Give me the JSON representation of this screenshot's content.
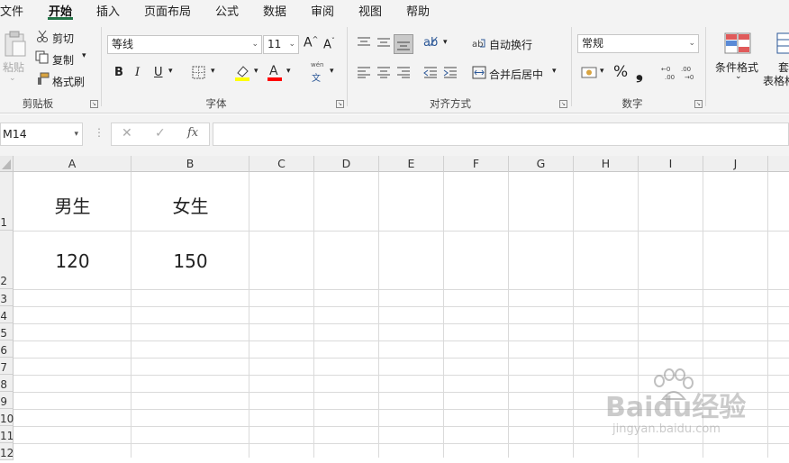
{
  "menu": {
    "items": [
      "文件",
      "开始",
      "插入",
      "页面布局",
      "公式",
      "数据",
      "审阅",
      "视图",
      "帮助"
    ]
  },
  "clipboard": {
    "paste": "粘贴",
    "cut": "剪切",
    "copy": "复制",
    "format_painter": "格式刷",
    "label": "剪贴板"
  },
  "font": {
    "family": "等线",
    "size": "11",
    "label": "字体",
    "bold": "B",
    "italic": "I",
    "underline": "U",
    "phonetic": "wén",
    "phonetic_char": "文"
  },
  "alignment": {
    "wrap_text": "自动换行",
    "merge_center": "合并后居中",
    "label": "对齐方式"
  },
  "number": {
    "format": "常规",
    "percent": "%",
    "comma": "❟",
    "label": "数字"
  },
  "styles": {
    "conditional_formatting": "条件格式",
    "format_as_table_top": "套",
    "format_as_table_bottom": "表格格"
  },
  "formula_bar": {
    "name_box": "M14",
    "fx": "fx",
    "formula": ""
  },
  "sheet": {
    "columns": [
      "A",
      "B",
      "C",
      "D",
      "E",
      "F",
      "G",
      "H",
      "I",
      "J"
    ],
    "rows": [
      "1",
      "2",
      "3",
      "4",
      "5",
      "6",
      "7",
      "8",
      "9",
      "10",
      "11",
      "12"
    ],
    "cells": {
      "A1": "男生",
      "B1": "女生",
      "A2": "120",
      "B2": "150"
    }
  },
  "watermark": {
    "brand": "Baidu经验",
    "url": "jingyan.baidu.com"
  }
}
